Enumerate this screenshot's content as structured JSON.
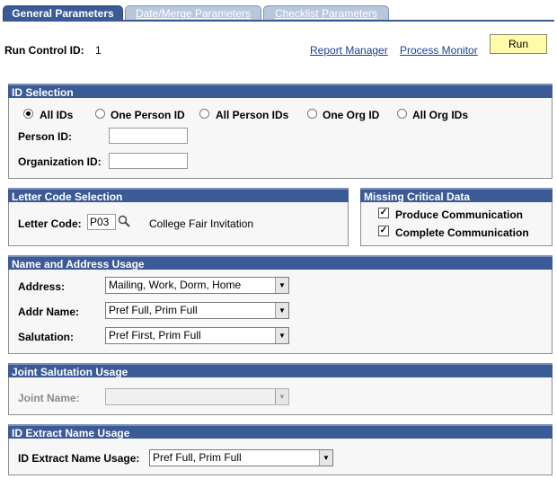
{
  "tabs": [
    {
      "label": "General Parameters"
    },
    {
      "label": "Date/Merge Parameters"
    },
    {
      "label": "Checklist Parameters"
    }
  ],
  "header": {
    "run_control_label": "Run Control ID:",
    "run_control_value": "1",
    "report_manager": "Report Manager",
    "process_monitor": "Process Monitor",
    "run": "Run"
  },
  "id_selection": {
    "title": "ID Selection",
    "options": [
      "All IDs",
      "One Person ID",
      "All Person IDs",
      "One Org ID",
      "All Org IDs"
    ],
    "selected": "All IDs",
    "person_id_label": "Person ID:",
    "person_id_value": "",
    "org_id_label": "Organization ID:",
    "org_id_value": ""
  },
  "letter_code": {
    "title": "Letter Code Selection",
    "label": "Letter Code:",
    "value": "P03",
    "description": "College Fair Invitation"
  },
  "missing_data": {
    "title": "Missing Critical Data",
    "produce": "Produce Communication",
    "produce_checked": true,
    "complete": "Complete Communication",
    "complete_checked": true
  },
  "name_address": {
    "title": "Name and Address Usage",
    "address_label": "Address:",
    "address_value": "Mailing, Work, Dorm, Home",
    "addr_name_label": "Addr Name:",
    "addr_name_value": "Pref Full, Prim Full",
    "salutation_label": "Salutation:",
    "salutation_value": "Pref First, Prim Full"
  },
  "joint": {
    "title": "Joint Salutation Usage",
    "label": "Joint Name:",
    "value": ""
  },
  "extract": {
    "title": "ID Extract Name Usage",
    "label": "ID Extract Name Usage:",
    "value": "Pref Full, Prim Full"
  },
  "colors": {
    "header_bar": "#3b5a96",
    "run_button": "#fffba8",
    "link": "#1c3f94"
  }
}
